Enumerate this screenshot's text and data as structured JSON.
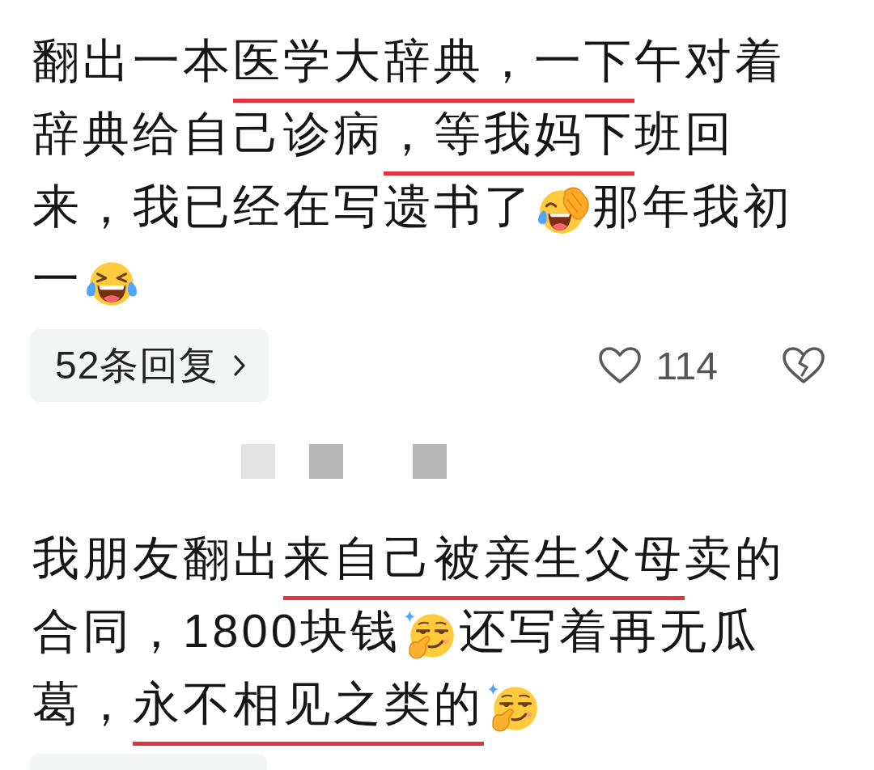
{
  "comments": [
    {
      "content": [
        {
          "kind": "text",
          "segments": [
            {
              "text": "翻出一本",
              "underlined": false
            },
            {
              "text": "医学大辞典，一下",
              "underlined": true
            },
            {
              "text": "午对着辞典给自己诊病",
              "underlined": false
            },
            {
              "text": "，等我妈下",
              "underlined": true
            },
            {
              "text": "班回来，我已经在写遗书了",
              "underlined": false
            }
          ]
        },
        {
          "kind": "facepalm"
        },
        {
          "kind": "text",
          "segments": [
            {
              "text": "那年我初一",
              "underlined": false
            }
          ]
        },
        {
          "kind": "laughing"
        }
      ],
      "replies_button": {
        "shown": true,
        "label": "52条回复"
      },
      "likes": {
        "count": "114",
        "liked": false
      },
      "dislike": {
        "disliked": false
      }
    },
    {
      "author_mosaic": [
        {
          "color": "#e3e3e3"
        },
        {
          "color": "#b6b6b6"
        },
        {
          "color": "#b6b6b6"
        }
      ],
      "content": [
        {
          "kind": "text",
          "segments": [
            {
              "text": "我朋友翻出",
              "underlined": false
            },
            {
              "text": "来自己被亲生父母",
              "underlined": true
            },
            {
              "text": "卖的合同，1800块钱",
              "underlined": false
            }
          ]
        },
        {
          "kind": "smirk"
        },
        {
          "kind": "text",
          "segments": [
            {
              "text": "还写着再无瓜葛，",
              "underlined": false
            },
            {
              "text": "永不相见之类的",
              "underlined": true
            }
          ]
        },
        {
          "kind": "smirk"
        }
      ],
      "replies_button": {
        "shown": true
      }
    }
  ]
}
